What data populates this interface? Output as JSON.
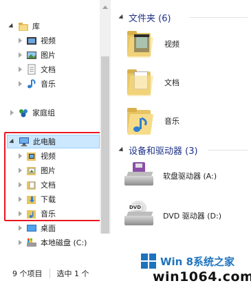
{
  "nav": {
    "items": [
      {
        "label": "库",
        "icon": "library-icon",
        "state": "expanded"
      },
      {
        "label": "视频",
        "icon": "videos-icon",
        "state": "collapsed"
      },
      {
        "label": "图片",
        "icon": "pictures-icon",
        "state": "collapsed"
      },
      {
        "label": "文档",
        "icon": "documents-icon",
        "state": "collapsed"
      },
      {
        "label": "音乐",
        "icon": "music-icon",
        "state": "collapsed"
      },
      {
        "label": "家庭组",
        "icon": "homegroup-icon",
        "state": "collapsed"
      },
      {
        "label": "此电脑",
        "icon": "this-pc-icon",
        "state": "expanded",
        "selected": true
      },
      {
        "label": "视频",
        "icon": "videos-folder-icon",
        "state": "collapsed"
      },
      {
        "label": "图片",
        "icon": "pictures-folder-icon",
        "state": "collapsed"
      },
      {
        "label": "文档",
        "icon": "documents-folder-icon",
        "state": "collapsed"
      },
      {
        "label": "下载",
        "icon": "downloads-folder-icon",
        "state": "collapsed"
      },
      {
        "label": "音乐",
        "icon": "music-folder-icon",
        "state": "collapsed"
      },
      {
        "label": "桌面",
        "icon": "desktop-folder-icon",
        "state": "collapsed"
      },
      {
        "label": "本地磁盘 (C:)",
        "icon": "local-disk-icon",
        "state": "collapsed"
      }
    ]
  },
  "content": {
    "folders_header": "文件夹 (6)",
    "folders": [
      {
        "label": "视频",
        "icon": "videos-folder-icon"
      },
      {
        "label": "文档",
        "icon": "documents-folder-icon"
      },
      {
        "label": "音乐",
        "icon": "music-folder-icon"
      }
    ],
    "devices_header": "设备和驱动器 (3)",
    "devices": [
      {
        "label": "软盘驱动器 (A:)",
        "icon": "floppy-drive-icon"
      },
      {
        "label": "DVD 驱动器 (D:)",
        "icon": "dvd-drive-icon"
      }
    ]
  },
  "status": {
    "item_count": "9 个项目",
    "selection": "选中 1 个"
  },
  "watermark": {
    "top_text": "Win 8系统之家",
    "bottom_text": "win1064.com"
  },
  "colors": {
    "selection_bg": "#cce8ff",
    "highlight_border": "#e8151f",
    "header_text": "#1e3287",
    "folder_yellow": "#f6dc8a",
    "watermark_blue": "#1e73be"
  }
}
